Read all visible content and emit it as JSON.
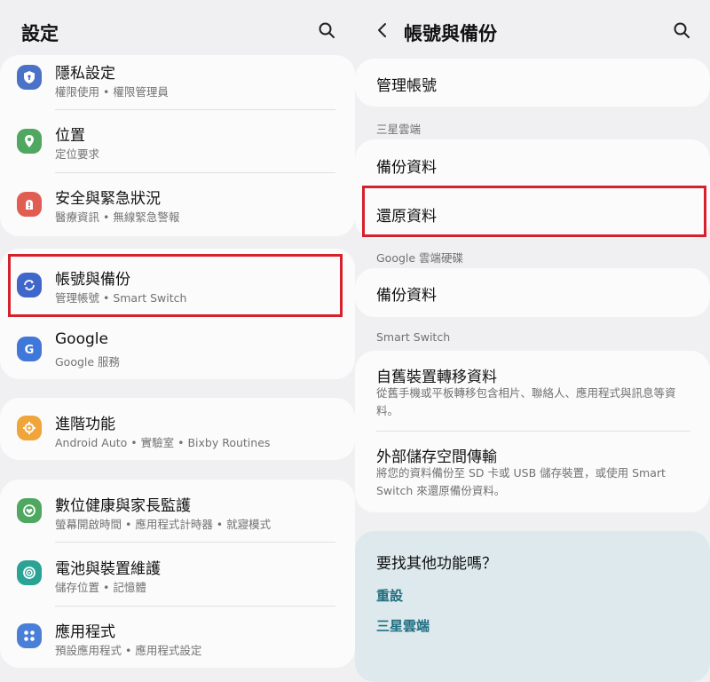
{
  "left": {
    "title": "設定",
    "items": [
      {
        "title": "隱私設定",
        "subtitle": "權限使用 • 權限管理員",
        "icon": "privacy-shield-icon",
        "color": "#4a72c6"
      },
      {
        "title": "位置",
        "subtitle": "定位要求",
        "icon": "location-pin-icon",
        "color": "#4fa760"
      },
      {
        "title": "安全與緊急狀況",
        "subtitle": "醫療資訊 • 無線緊急警報",
        "icon": "emergency-icon",
        "color": "#e15d52"
      },
      {
        "title": "帳號與備份",
        "subtitle": "管理帳號 • Smart Switch",
        "icon": "sync-icon",
        "color": "#3f67c9"
      },
      {
        "title": "Google",
        "subtitle": "Google 服務",
        "icon": "google-icon",
        "color": "#3f78d8"
      },
      {
        "title": "進階功能",
        "subtitle": "Android Auto • 實驗室 • Bixby Routines",
        "icon": "advanced-features-icon",
        "color": "#f0a53b"
      },
      {
        "title": "數位健康與家長監護",
        "subtitle": "螢幕開啟時間 • 應用程式計時器 • 就寢模式",
        "icon": "wellbeing-icon",
        "color": "#4fa760"
      },
      {
        "title": "電池與裝置維護",
        "subtitle": "儲存位置 • 記憶體",
        "icon": "device-care-icon",
        "color": "#2aa394"
      },
      {
        "title": "應用程式",
        "subtitle": "預設應用程式 • 應用程式設定",
        "icon": "apps-icon",
        "color": "#4a7fd8"
      }
    ]
  },
  "right": {
    "title": "帳號與備份",
    "manage_accounts": "管理帳號",
    "samsung_cloud": {
      "label": "三星雲端",
      "backup": "備份資料",
      "restore": "還原資料"
    },
    "google_drive": {
      "label": "Google 雲端硬碟",
      "backup": "備份資料"
    },
    "smart_switch": {
      "label": "Smart Switch",
      "transfer_title": "自舊裝置轉移資料",
      "transfer_sub": "從舊手機或平板轉移包含相片、聯絡人、應用程式與訊息等資料。",
      "external_title": "外部儲存空間傳輸",
      "external_sub": "將您的資料備份至 SD 卡或 USB 儲存裝置，或使用 Smart Switch 來還原備份資料。"
    },
    "help": {
      "title": "要找其他功能嗎？",
      "links": [
        "重設",
        "三星雲端"
      ]
    }
  },
  "colors": {
    "highlight": "#d6202c",
    "link": "#1f6d80",
    "background": "#f0f0f2",
    "card": "#fbfbfb",
    "help_card": "#dde9ed"
  }
}
